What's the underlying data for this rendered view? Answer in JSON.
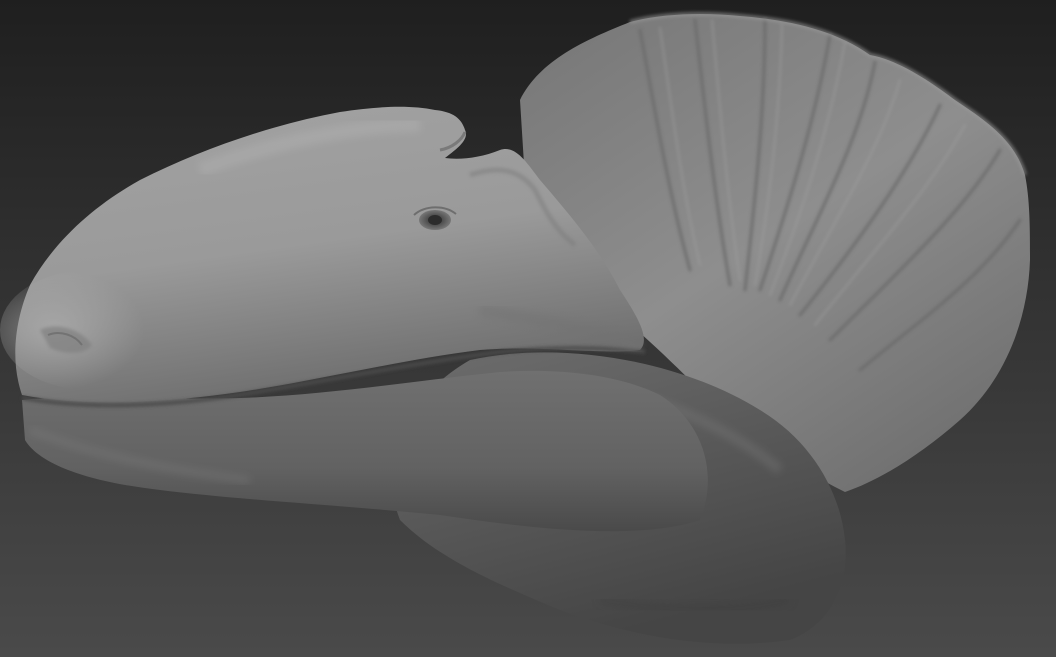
{
  "scene": {
    "subject": "sculpted-dinosaur-head",
    "colors": {
      "background_top": "#1f1f1f",
      "background_bottom": "#4a4a4a",
      "clay_light": "#b0b0b0",
      "clay_mid": "#8f8f8f",
      "clay_dark": "#5a5a5a",
      "clay_shadow": "#3c3c3c"
    }
  }
}
